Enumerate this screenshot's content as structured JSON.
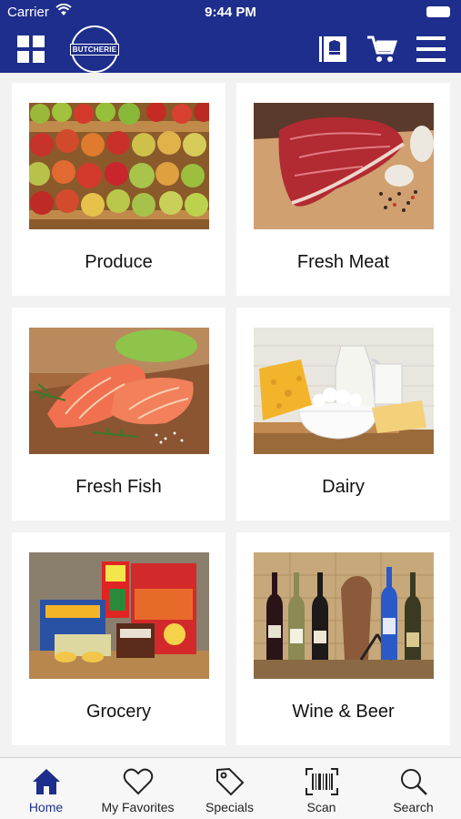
{
  "status": {
    "carrier": "Carrier",
    "time": "9:44 PM"
  },
  "header": {
    "logo_text": "BUTCHERIE",
    "icons": [
      "grid-menu-icon",
      "recipe-book-icon",
      "cart-icon",
      "hamburger-menu-icon"
    ]
  },
  "categories": [
    {
      "label": "Produce"
    },
    {
      "label": "Fresh Meat"
    },
    {
      "label": "Fresh Fish"
    },
    {
      "label": "Dairy"
    },
    {
      "label": "Grocery"
    },
    {
      "label": "Wine & Beer"
    }
  ],
  "tabs": [
    {
      "label": "Home",
      "icon": "home-icon",
      "active": true
    },
    {
      "label": "My Favorites",
      "icon": "heart-icon"
    },
    {
      "label": "Specials",
      "icon": "tag-icon"
    },
    {
      "label": "Scan",
      "icon": "barcode-icon"
    },
    {
      "label": "Search",
      "icon": "search-icon"
    }
  ],
  "colors": {
    "brand": "#1e2e8c",
    "active_tab": "#1e2e8c"
  }
}
